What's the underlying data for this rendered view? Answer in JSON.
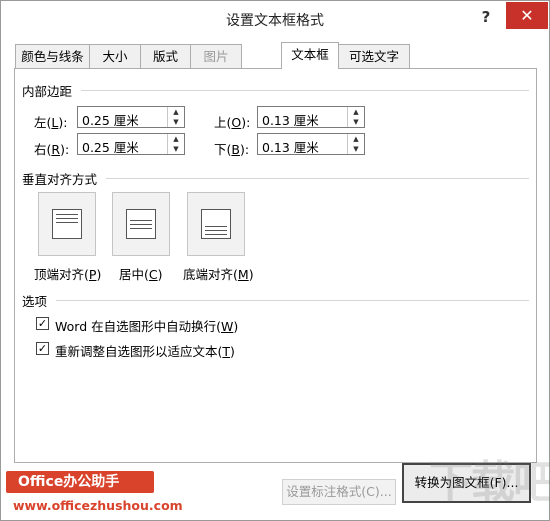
{
  "window": {
    "title": "设置文本框格式",
    "help_label": "?",
    "close_label": "✕"
  },
  "tabs": [
    {
      "label": "颜色与线条",
      "state": "normal"
    },
    {
      "label": "大小",
      "state": "normal"
    },
    {
      "label": "版式",
      "state": "normal"
    },
    {
      "label": "图片",
      "state": "disabled"
    },
    {
      "label": "文本框",
      "state": "active"
    },
    {
      "label": "可选文字",
      "state": "normal"
    }
  ],
  "internal_margin": {
    "section_label": "内部边距",
    "left": {
      "label_text": "左(",
      "accel": "L",
      "label_end": "):",
      "value": "0.25 厘米"
    },
    "right": {
      "label_text": "右(",
      "accel": "R",
      "label_end": "):",
      "value": "0.25 厘米"
    },
    "top": {
      "label_text": "上(",
      "accel": "O",
      "label_end": "):",
      "value": "0.13 厘米"
    },
    "bottom": {
      "label_text": "下(",
      "accel": "B",
      "label_end": "):",
      "value": "0.13 厘米"
    }
  },
  "vertical_alignment": {
    "section_label": "垂直对齐方式",
    "options": [
      {
        "label_text": "顶端对齐(",
        "accel": "P",
        "label_end": ")",
        "icon": "align-top-icon"
      },
      {
        "label_text": "居中(",
        "accel": "C",
        "label_end": ")",
        "icon": "align-middle-icon"
      },
      {
        "label_text": "底端对齐(",
        "accel": "M",
        "label_end": ")",
        "icon": "align-bottom-icon"
      }
    ]
  },
  "options": {
    "section_label": "选项",
    "word_wrap": {
      "label_text": "Word 在自选图形中自动换行(",
      "accel": "W",
      "label_end": ")",
      "checked": true
    },
    "resize_shape": {
      "label_text": "重新调整自选图形以适应文本(",
      "accel": "T",
      "label_end": ")",
      "checked": true
    }
  },
  "buttons": {
    "callout_format": "设置标注格式(C)...",
    "convert_to_frame": "转换为图文框(F)..."
  },
  "watermark": {
    "brand": "Office办公助手",
    "url": "www.officezhushou.com",
    "logo_text": "下载吧"
  },
  "colors": {
    "close_button": "#c7312a",
    "brand": "#d9432b"
  }
}
